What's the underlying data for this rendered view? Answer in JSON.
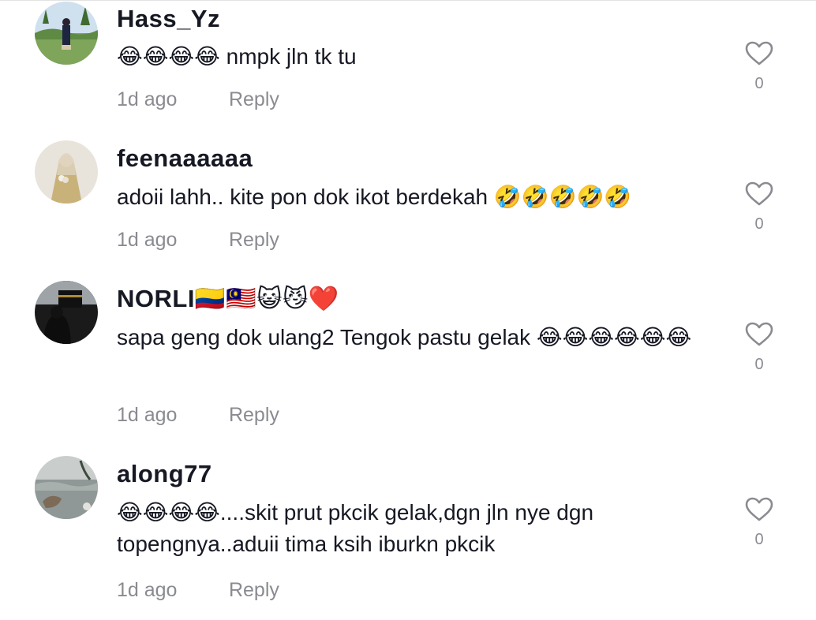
{
  "comments": [
    {
      "username": "Hass_Yz",
      "text": "😂😂😂😂 nmpk jln tk tu",
      "time": "1d ago",
      "reply_label": "Reply",
      "like_count": "0"
    },
    {
      "username": "feenaaaaaa",
      "text": "adoii lahh.. kite pon dok ikot berdekah 🤣🤣🤣🤣🤣",
      "time": "1d ago",
      "reply_label": "Reply",
      "like_count": "0"
    },
    {
      "username": "NORLI🇨🇴🇲🇾😺😼❤️",
      "text": "sapa geng dok ulang2 Tengok pastu gelak 😂😂😂😂😂😂",
      "time": "1d ago",
      "reply_label": "Reply",
      "like_count": "0"
    },
    {
      "username": "along77",
      "text": "😂😂😂😂....skit prut pkcik gelak,dgn jln nye dgn topengnya..aduii tima ksih iburkn pkcik",
      "time": "1d ago",
      "reply_label": "Reply",
      "like_count": "0"
    }
  ],
  "icons": {
    "like": "heart-outline-icon"
  },
  "colors": {
    "username": "#161823",
    "meta": "#8a8b91",
    "heart": "#8a8b91"
  }
}
